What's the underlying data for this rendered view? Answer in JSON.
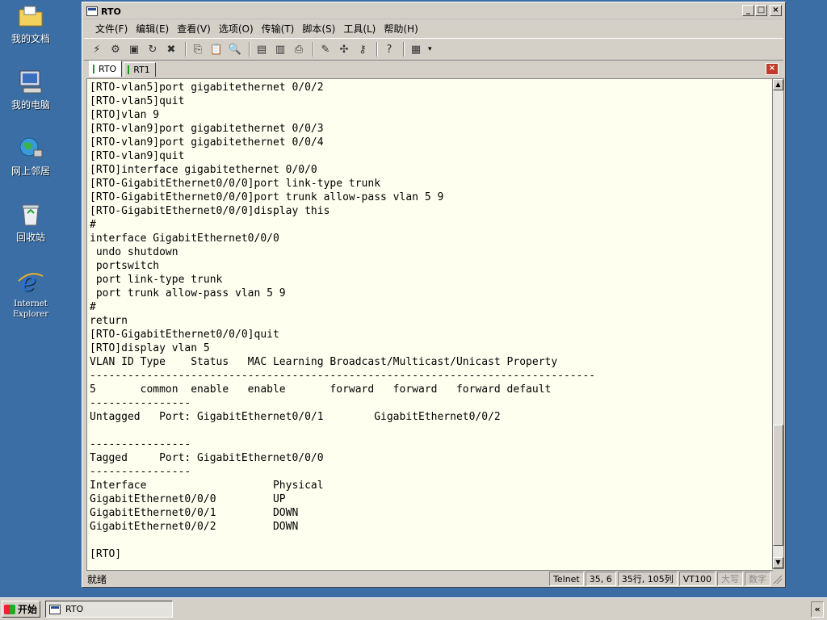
{
  "desktop": {
    "icons": [
      {
        "label": "我的文档"
      },
      {
        "label": "我的电脑"
      },
      {
        "label": "网上邻居"
      },
      {
        "label": "回收站"
      },
      {
        "label_line1": "Internet",
        "label_line2": "Explorer"
      }
    ]
  },
  "window": {
    "title": "RTO",
    "buttons": {
      "minimize": "_",
      "maximize": "□",
      "close": "×"
    }
  },
  "menu": [
    "文件(F)",
    "编辑(E)",
    "查看(V)",
    "选项(O)",
    "传输(T)",
    "脚本(S)",
    "工具(L)",
    "帮助(H)"
  ],
  "tabs": [
    {
      "label": "RTO",
      "active": true
    },
    {
      "label": "RT1",
      "active": false
    }
  ],
  "terminal": {
    "lines": [
      "[RTO-vlan5]port gigabitethernet 0/0/2",
      "[RTO-vlan5]quit",
      "[RTO]vlan 9",
      "[RTO-vlan9]port gigabitethernet 0/0/3",
      "[RTO-vlan9]port gigabitethernet 0/0/4",
      "[RTO-vlan9]quit",
      "[RTO]interface gigabitethernet 0/0/0",
      "[RTO-GigabitEthernet0/0/0]port link-type trunk",
      "[RTO-GigabitEthernet0/0/0]port trunk allow-pass vlan 5 9",
      "[RTO-GigabitEthernet0/0/0]display this",
      "#",
      "interface GigabitEthernet0/0/0",
      " undo shutdown",
      " portswitch",
      " port link-type trunk",
      " port trunk allow-pass vlan 5 9",
      "#",
      "return",
      "[RTO-GigabitEthernet0/0/0]quit",
      "[RTO]display vlan 5",
      "VLAN ID Type    Status   MAC Learning Broadcast/Multicast/Unicast Property",
      "--------------------------------------------------------------------------------",
      "5       common  enable   enable       forward   forward   forward default",
      "----------------",
      "Untagged   Port: GigabitEthernet0/0/1        GigabitEthernet0/0/2",
      "",
      "----------------",
      "Tagged     Port: GigabitEthernet0/0/0",
      "----------------",
      "Interface                    Physical",
      "GigabitEthernet0/0/0         UP",
      "GigabitEthernet0/0/1         DOWN",
      "GigabitEthernet0/0/2         DOWN",
      "",
      "[RTO]"
    ]
  },
  "status": {
    "ready": "就绪",
    "protocol": "Telnet",
    "cursor": "35,   6",
    "rowcol": "35行, 105列",
    "emulation": "VT100",
    "caps": "大写",
    "num": "数字"
  },
  "taskbar": {
    "start": "开始",
    "task": "RTO",
    "tray": "«"
  }
}
